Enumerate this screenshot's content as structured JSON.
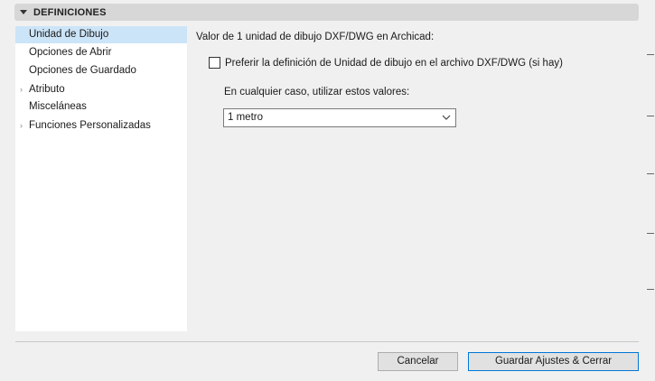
{
  "section": {
    "title": "DEFINICIONES"
  },
  "sidebar": {
    "items": [
      {
        "label": "Unidad de Dibujo",
        "selected": true,
        "expandable": false
      },
      {
        "label": "Opciones de Abrir",
        "selected": false,
        "expandable": false
      },
      {
        "label": "Opciones de Guardado",
        "selected": false,
        "expandable": false
      },
      {
        "label": "Atributo",
        "selected": false,
        "expandable": true
      },
      {
        "label": "Misceláneas",
        "selected": false,
        "expandable": false
      },
      {
        "label": "Funciones Personalizadas",
        "selected": false,
        "expandable": true
      }
    ]
  },
  "content": {
    "heading": "Valor de 1 unidad de dibujo DXF/DWG en Archicad:",
    "checkbox_label": "Preferir la definición de Unidad de dibujo en el archivo DXF/DWG (si hay)",
    "checkbox_checked": false,
    "subheading": "En cualquier caso, utilizar estos valores:",
    "unit_select_value": "1 metro"
  },
  "buttons": {
    "cancel_label": "Cancelar",
    "save_label": "Guardar Ajustes & Cerrar"
  },
  "colors": {
    "selected_bg": "#cce4f7",
    "primary_border": "#0078d7",
    "header_bg": "#d7d7d7"
  },
  "icons": {
    "section_toggle": "caret-down-icon",
    "expand": "chevron-right-icon",
    "dropdown": "chevron-down-icon"
  }
}
